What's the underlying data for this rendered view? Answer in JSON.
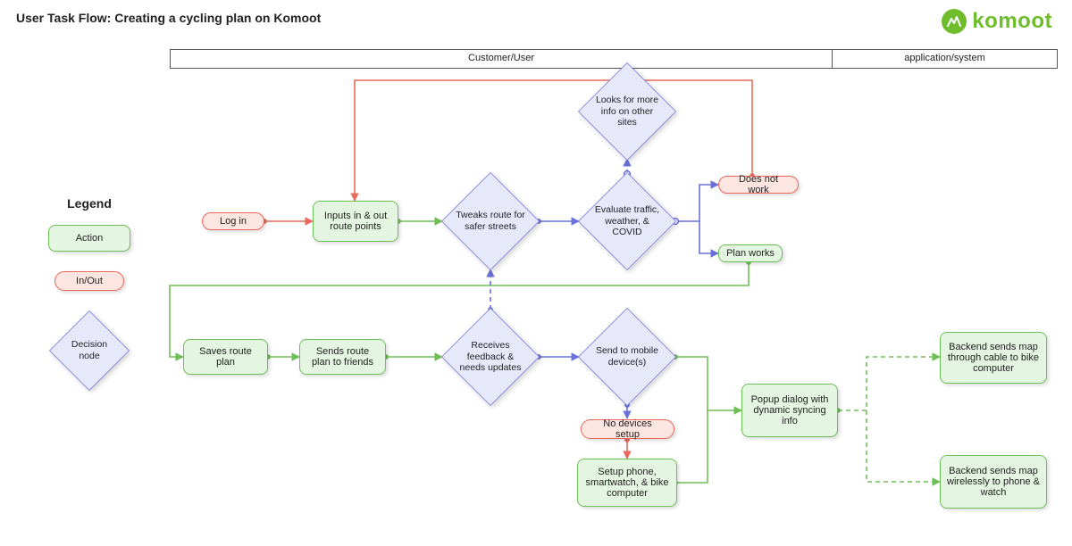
{
  "title": "User Task Flow: Creating a cycling plan on Komoot",
  "brand": {
    "name": "komoot"
  },
  "swimlanes": {
    "user": "Customer/User",
    "system": "application/system"
  },
  "legend": {
    "heading": "Legend",
    "action": "Action",
    "inout": "In/Out",
    "decision": "Decision node"
  },
  "colors": {
    "green": "#6fbf59",
    "greenFill": "#e4f5e1",
    "red": "#e86a5c",
    "redFill": "#fde5e2",
    "blue": "#6a70d8",
    "blueFill": "#e7e9fb"
  },
  "nodes": {
    "login": {
      "label": "Log in"
    },
    "inputs": {
      "label": "Inputs in & out route points"
    },
    "tweaks": {
      "label": "Tweaks route for safer streets"
    },
    "evaluate": {
      "label": "Evaluate traffic, weather, & COVID"
    },
    "lookinfo": {
      "label": "Looks for more info on other sites"
    },
    "doesnotwork": {
      "label": "Does not work"
    },
    "planworks": {
      "label": "Plan works"
    },
    "saves": {
      "label": "Saves route plan"
    },
    "sends": {
      "label": "Sends route plan to friends"
    },
    "feedback": {
      "label": "Receives feedback & needs updates"
    },
    "sendmobile": {
      "label": "Send to mobile device(s)"
    },
    "nodevices": {
      "label": "No devices setup"
    },
    "setup": {
      "label": "Setup phone, smartwatch, & bike computer"
    },
    "popup": {
      "label": "Popup dialog with dynamic syncing info"
    },
    "backendcable": {
      "label": "Backend sends map through cable to bike computer"
    },
    "backendwireless": {
      "label": "Backend sends map wirelessly to phone & watch"
    }
  },
  "chart_data": {
    "type": "flowchart",
    "swimlanes": [
      "Customer/User",
      "application/system"
    ],
    "node_types": {
      "action": "rounded-rect green",
      "inout": "pill red",
      "decision": "diamond blue"
    },
    "nodes": [
      {
        "id": "login",
        "type": "inout",
        "lane": "Customer/User",
        "label": "Log in"
      },
      {
        "id": "inputs",
        "type": "action",
        "lane": "Customer/User",
        "label": "Inputs in & out route points"
      },
      {
        "id": "tweaks",
        "type": "decision",
        "lane": "Customer/User",
        "label": "Tweaks route for safer streets"
      },
      {
        "id": "evaluate",
        "type": "decision",
        "lane": "Customer/User",
        "label": "Evaluate traffic, weather, & COVID"
      },
      {
        "id": "lookinfo",
        "type": "decision",
        "lane": "Customer/User",
        "label": "Looks for more info on other sites"
      },
      {
        "id": "doesnotwork",
        "type": "inout",
        "lane": "Customer/User",
        "label": "Does not work"
      },
      {
        "id": "planworks",
        "type": "action",
        "lane": "Customer/User",
        "label": "Plan works"
      },
      {
        "id": "saves",
        "type": "action",
        "lane": "Customer/User",
        "label": "Saves route plan"
      },
      {
        "id": "sends",
        "type": "action",
        "lane": "Customer/User",
        "label": "Sends route plan to friends"
      },
      {
        "id": "feedback",
        "type": "decision",
        "lane": "Customer/User",
        "label": "Receives feedback & needs updates"
      },
      {
        "id": "sendmobile",
        "type": "decision",
        "lane": "Customer/User",
        "label": "Send to mobile device(s)"
      },
      {
        "id": "nodevices",
        "type": "inout",
        "lane": "Customer/User",
        "label": "No devices setup"
      },
      {
        "id": "setup",
        "type": "action",
        "lane": "Customer/User",
        "label": "Setup phone, smartwatch, & bike computer"
      },
      {
        "id": "popup",
        "type": "action",
        "lane": "Customer/User",
        "label": "Popup dialog with dynamic syncing info"
      },
      {
        "id": "backendcable",
        "type": "action",
        "lane": "application/system",
        "label": "Backend sends map through cable to bike computer"
      },
      {
        "id": "backendwireless",
        "type": "action",
        "lane": "application/system",
        "label": "Backend sends map wirelessly to phone & watch"
      }
    ],
    "edges": [
      {
        "from": "login",
        "to": "inputs",
        "style": "solid",
        "color": "red"
      },
      {
        "from": "inputs",
        "to": "tweaks",
        "style": "solid",
        "color": "green"
      },
      {
        "from": "tweaks",
        "to": "evaluate",
        "style": "solid",
        "color": "blue"
      },
      {
        "from": "evaluate",
        "to": "lookinfo",
        "style": "dashed",
        "color": "blue"
      },
      {
        "from": "evaluate",
        "to": "doesnotwork",
        "style": "solid",
        "color": "blue"
      },
      {
        "from": "evaluate",
        "to": "planworks",
        "style": "solid",
        "color": "blue"
      },
      {
        "from": "doesnotwork",
        "to": "inputs",
        "style": "solid",
        "color": "red",
        "note": "loop back"
      },
      {
        "from": "planworks",
        "to": "saves",
        "style": "solid",
        "color": "green"
      },
      {
        "from": "saves",
        "to": "sends",
        "style": "solid",
        "color": "green"
      },
      {
        "from": "sends",
        "to": "feedback",
        "style": "solid",
        "color": "green"
      },
      {
        "from": "feedback",
        "to": "tweaks",
        "style": "dashed",
        "color": "blue",
        "note": "loop back"
      },
      {
        "from": "feedback",
        "to": "sendmobile",
        "style": "solid",
        "color": "blue"
      },
      {
        "from": "sendmobile",
        "to": "nodevices",
        "style": "solid",
        "color": "blue"
      },
      {
        "from": "nodevices",
        "to": "setup",
        "style": "solid",
        "color": "red"
      },
      {
        "from": "sendmobile",
        "to": "popup",
        "style": "solid",
        "color": "green"
      },
      {
        "from": "setup",
        "to": "popup",
        "style": "solid",
        "color": "green"
      },
      {
        "from": "popup",
        "to": "backendcable",
        "style": "dashed",
        "color": "green"
      },
      {
        "from": "popup",
        "to": "backendwireless",
        "style": "dashed",
        "color": "green"
      }
    ]
  }
}
